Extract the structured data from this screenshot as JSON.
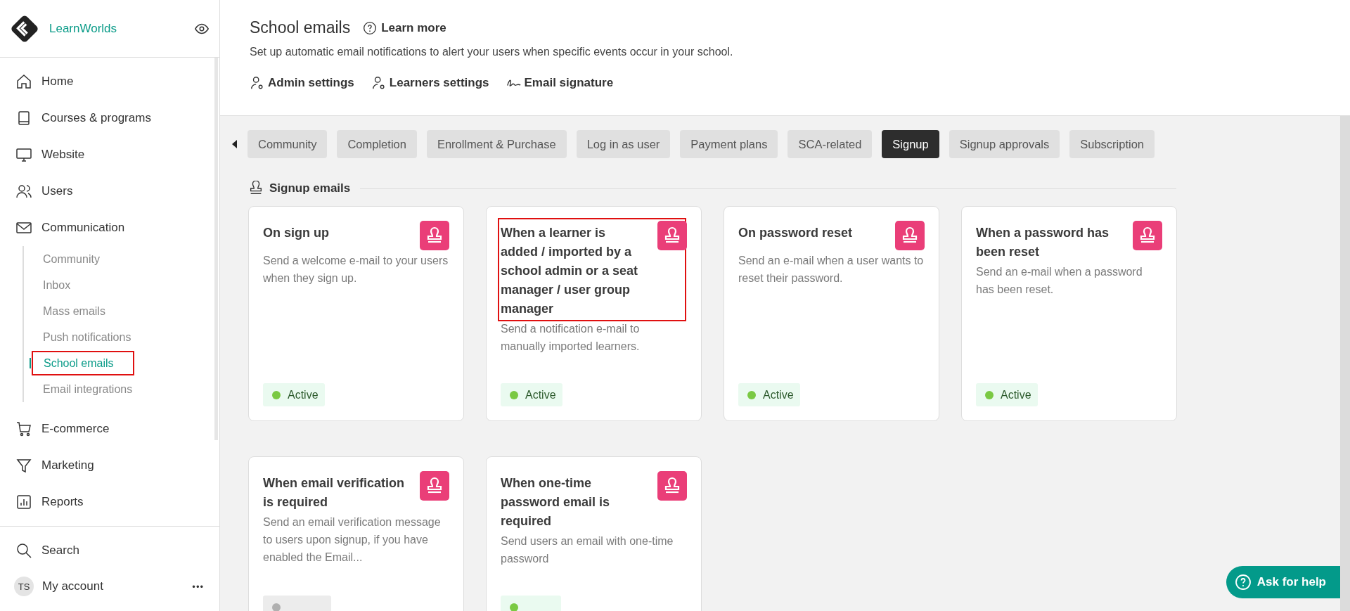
{
  "brand": {
    "name": "LearnWorlds"
  },
  "sidebar": {
    "items": [
      {
        "label": "Home"
      },
      {
        "label": "Courses & programs"
      },
      {
        "label": "Website"
      },
      {
        "label": "Users"
      },
      {
        "label": "Communication",
        "children": [
          {
            "label": "Community",
            "selected": false,
            "highlighted": false
          },
          {
            "label": "Inbox",
            "selected": false,
            "highlighted": false
          },
          {
            "label": "Mass emails",
            "selected": false,
            "highlighted": false
          },
          {
            "label": "Push notifications",
            "selected": false,
            "highlighted": false
          },
          {
            "label": "School emails",
            "selected": true,
            "highlighted": true
          },
          {
            "label": "Email integrations",
            "selected": false,
            "highlighted": false
          }
        ]
      },
      {
        "label": "E-commerce"
      },
      {
        "label": "Marketing"
      },
      {
        "label": "Reports"
      }
    ],
    "search": "Search",
    "account": {
      "initials": "TS",
      "label": "My account",
      "menu": "•••"
    }
  },
  "header": {
    "title": "School emails",
    "learn_more": "Learn more",
    "subtitle": "Set up automatic email notifications to alert your users when specific events occur in your school.",
    "links": [
      {
        "label": "Admin settings"
      },
      {
        "label": "Learners settings"
      },
      {
        "label": "Email signature"
      }
    ]
  },
  "tabs": [
    {
      "label": "Community",
      "selected": false
    },
    {
      "label": "Completion",
      "selected": false
    },
    {
      "label": "Enrollment & Purchase",
      "selected": false
    },
    {
      "label": "Log in as user",
      "selected": false
    },
    {
      "label": "Payment plans",
      "selected": false
    },
    {
      "label": "SCA-related",
      "selected": false
    },
    {
      "label": "Signup",
      "selected": true
    },
    {
      "label": "Signup approvals",
      "selected": false
    },
    {
      "label": "Subscription",
      "selected": false
    }
  ],
  "section": {
    "title": "Signup emails"
  },
  "cards": [
    {
      "title": "On sign up",
      "description": "Send a welcome e-mail to your users when they sign up.",
      "active": true,
      "status": "Active",
      "highlighted": false
    },
    {
      "title": "When a learner is added / imported by a school admin or a seat manager / user group manager",
      "description": "Send a notification e-mail to manually imported learners.",
      "active": true,
      "status": "Active",
      "highlighted": true
    },
    {
      "title": "On password reset",
      "description": "Send an e-mail when a user wants to reset their password.",
      "active": true,
      "status": "Active",
      "highlighted": false
    },
    {
      "title": "When a password has been reset",
      "description": "Send an e-mail when a password has been reset.",
      "active": true,
      "status": "Active",
      "highlighted": false
    },
    {
      "title": "When email verification is required",
      "description": "Send an email verification message to users upon signup, if you have enabled the Email...",
      "active": false,
      "highlighted": false
    },
    {
      "title": "When one-time password email is required",
      "description": "Send users an email with one-time password",
      "active": true,
      "highlighted": false
    }
  ],
  "help_button": {
    "label": "Ask for help"
  }
}
